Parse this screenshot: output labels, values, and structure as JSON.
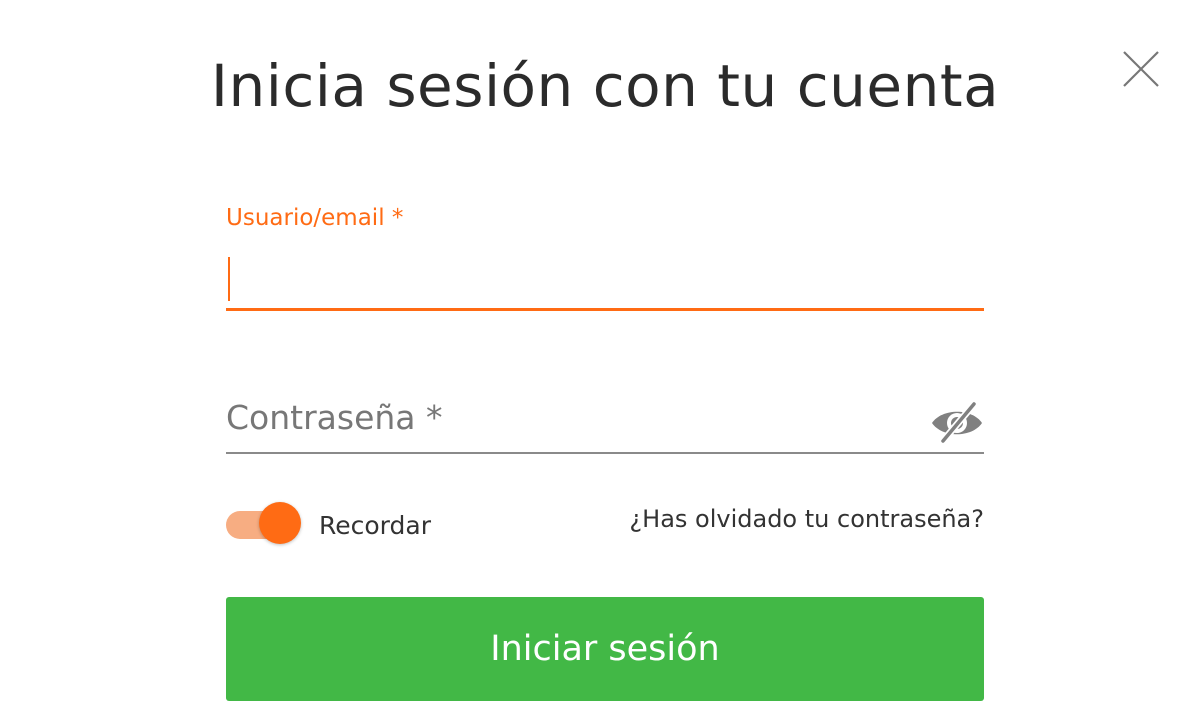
{
  "dialog": {
    "title": "Inicia sesión con tu cuenta",
    "close_icon": "close-icon"
  },
  "form": {
    "username": {
      "label": "Usuario/email *",
      "value": ""
    },
    "password": {
      "label": "Contraseña *",
      "value": "",
      "toggle_icon": "eye-slash-icon"
    },
    "remember": {
      "label": "Recordar",
      "checked": true
    },
    "forgot_label": "¿Has olvidado tu contraseña?",
    "submit_label": "Iniciar sesión"
  },
  "colors": {
    "accent": "#ff6b14",
    "primary": "#42b846",
    "toggle_track": "#f7ad82"
  }
}
